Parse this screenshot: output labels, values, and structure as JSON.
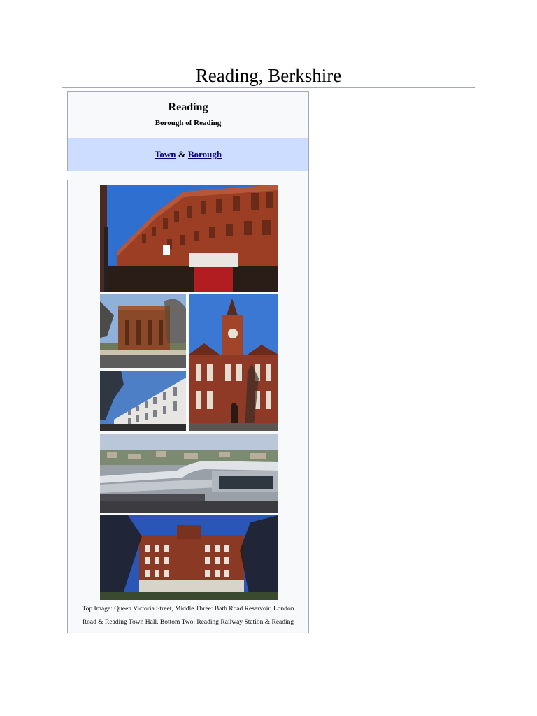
{
  "page": {
    "title": "Reading, Berkshire"
  },
  "infobox": {
    "name": "Reading",
    "official_name": "Borough of Reading",
    "type_link_1": "Town",
    "type_connector": "&",
    "type_link_2": "Borough",
    "caption_line_1": "Top Image: Queen Victoria Street, Middle Three: Bath Road Reservoir, London",
    "caption_line_2": "Road & Reading Town Hall, Bottom Two: Reading Railway Station & Reading",
    "images": [
      {
        "subject": "queen-victoria-street"
      },
      {
        "subject": "bath-road-reservoir"
      },
      {
        "subject": "london-road"
      },
      {
        "subject": "reading-town-hall"
      },
      {
        "subject": "reading-railway-station"
      },
      {
        "subject": "reading-building"
      }
    ]
  },
  "colors": {
    "sky": "#2f6fd0",
    "brick": "#9c3e24",
    "link": "#0b0080",
    "type_band": "#ccddff",
    "border": "#a2a9b1"
  }
}
